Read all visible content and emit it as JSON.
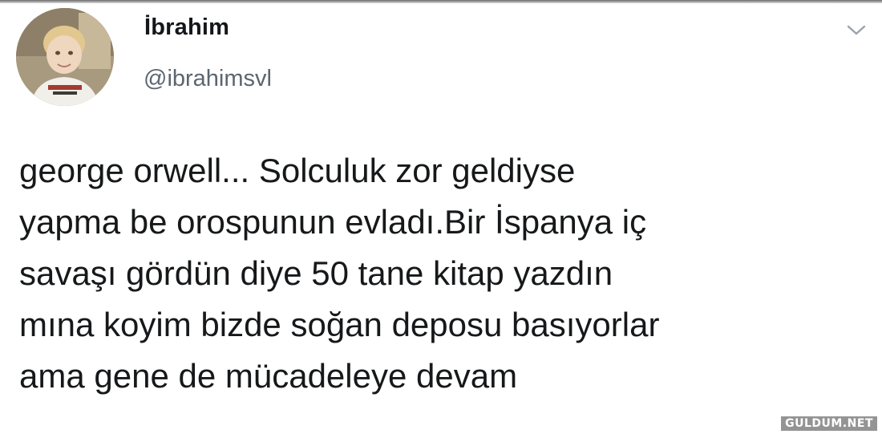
{
  "tweet": {
    "author": {
      "display_name": "İbrahim",
      "handle": "@ibrahimsvl",
      "avatar": "child-photo-avatar"
    },
    "menu_icon": "chevron-down-icon",
    "text_lines": [
      "george orwell... Solculuk zor geldiyse",
      "yapma be orospunun evladı.Bir İspanya iç",
      "savaşı gördün diye 50 tane kitap yazdın",
      "mına koyim bizde soğan deposu basıyorlar",
      "ama gene de mücadeleye devam"
    ]
  },
  "watermark": {
    "text": "GULDUM.NET"
  },
  "colors": {
    "background": "#ffffff",
    "text": "#161819",
    "handle": "#5b6670",
    "chevron": "#9aa4ad"
  }
}
